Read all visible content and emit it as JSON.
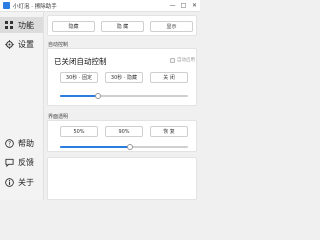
{
  "window": {
    "title": "小灯泡 · 擦除助手",
    "app_icon": "app-icon",
    "controls": {
      "minimize": "—",
      "maximize": "□",
      "close": "✕"
    }
  },
  "sidebar": {
    "items": [
      {
        "label": "功能",
        "icon": "grid-icon",
        "active": true
      },
      {
        "label": "设置",
        "icon": "gear-icon",
        "active": false
      },
      {
        "label": "帮助",
        "icon": "help-icon",
        "active": false
      },
      {
        "label": "反馈",
        "icon": "feedback-icon",
        "active": false
      },
      {
        "label": "关于",
        "icon": "info-icon",
        "active": false
      }
    ]
  },
  "top_actions": {
    "hide_label": "隐藏",
    "hidden_label": "隐 藏",
    "show_label": "显示"
  },
  "auto_control": {
    "section_label": "自动控制",
    "status": "已关闭自动控制",
    "checkbox_label": "自动启用",
    "buttons": [
      "30秒 · 固定",
      "30秒 · 隐藏",
      "关 闭"
    ],
    "slider": {
      "value": 0.3,
      "accent": "#2a7de1"
    }
  },
  "opacity": {
    "section_label": "界面透明",
    "buttons": [
      "50%",
      "90%",
      "恢 复"
    ],
    "slider": {
      "value": 0.55,
      "accent": "#2a7de1"
    }
  }
}
